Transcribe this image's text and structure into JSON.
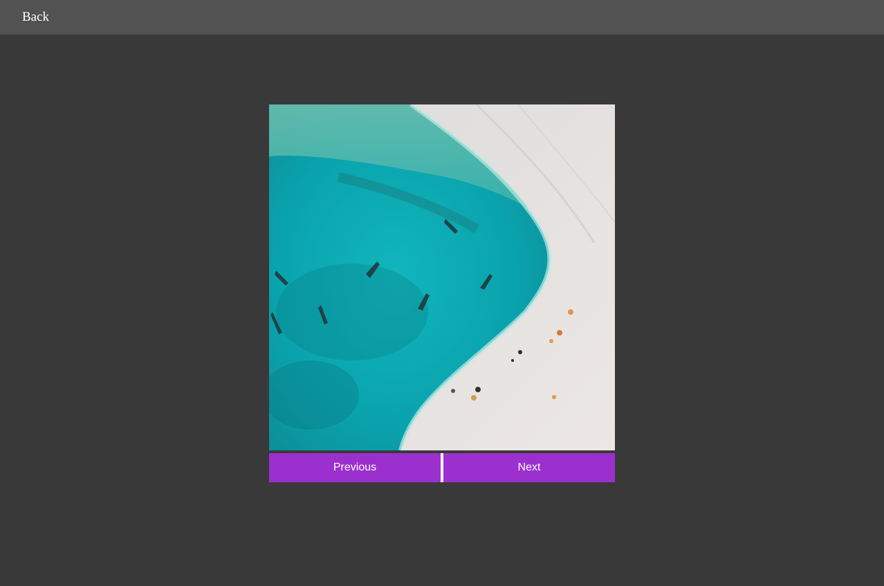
{
  "header": {
    "back_label": "Back"
  },
  "gallery": {
    "image_description_icon": "aerial-beach-photo",
    "previous_label": "Previous",
    "next_label": "Next"
  },
  "colors": {
    "page_background": "#393939",
    "topbar_background": "#525252",
    "button_background": "#9b30cf",
    "button_text": "#ffffff"
  }
}
